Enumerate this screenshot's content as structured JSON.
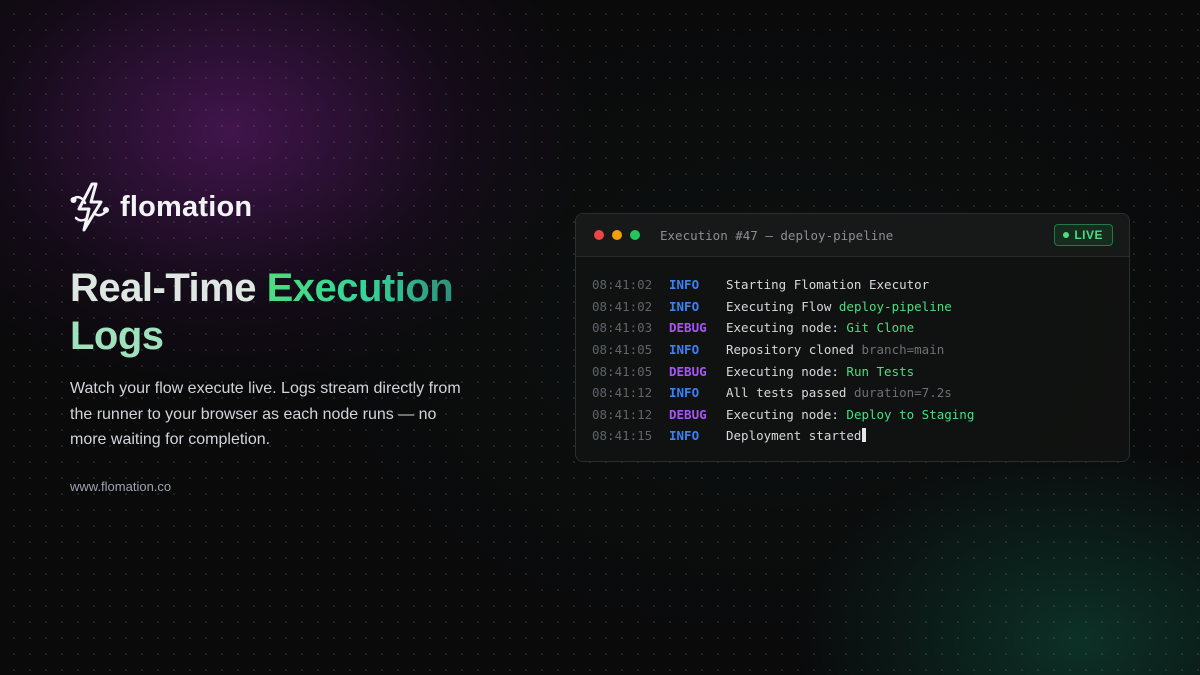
{
  "brand": {
    "name": "flomation",
    "logo_icon": "lightning-node-icon"
  },
  "headline": {
    "part1": "Real-Time ",
    "part2": "Execution",
    "part3": "Logs"
  },
  "description": "Watch your flow execute live. Logs stream directly from the runner to your browser as each node runs — no more waiting for completion.",
  "url": "www.flomation.co",
  "colors": {
    "accent_green": "#4ade80",
    "info_blue": "#3b82f6",
    "debug_purple": "#a855f7",
    "background": "#0a0a0b"
  },
  "terminal": {
    "title": "Execution #47 — deploy-pipeline",
    "badge": "LIVE",
    "logs": [
      {
        "time": "08:41:02",
        "level": "INFO",
        "text": "Starting Flomation Executor",
        "highlight": "",
        "meta": ""
      },
      {
        "time": "08:41:02",
        "level": "INFO",
        "text": "Executing Flow ",
        "highlight": "deploy-pipeline",
        "meta": ""
      },
      {
        "time": "08:41:03",
        "level": "DEBUG",
        "text": "Executing node: ",
        "highlight": "Git Clone",
        "meta": ""
      },
      {
        "time": "08:41:05",
        "level": "INFO",
        "text": "Repository cloned ",
        "highlight": "",
        "meta": "branch=main"
      },
      {
        "time": "08:41:05",
        "level": "DEBUG",
        "text": "Executing node: ",
        "highlight": "Run Tests",
        "meta": ""
      },
      {
        "time": "08:41:12",
        "level": "INFO",
        "text": "All tests passed ",
        "highlight": "",
        "meta": "duration=7.2s"
      },
      {
        "time": "08:41:12",
        "level": "DEBUG",
        "text": "Executing node: ",
        "highlight": "Deploy to Staging",
        "meta": ""
      },
      {
        "time": "08:41:15",
        "level": "INFO",
        "text": "Deployment started",
        "highlight": "",
        "meta": ""
      }
    ]
  }
}
